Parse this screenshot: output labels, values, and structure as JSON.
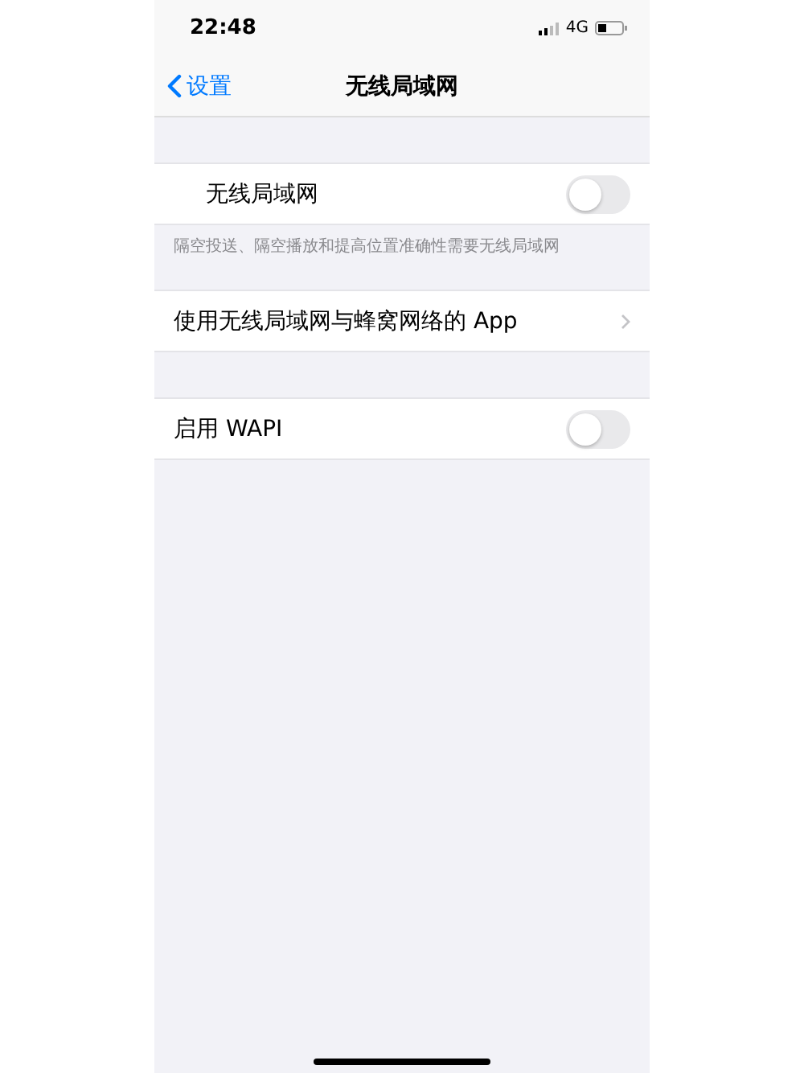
{
  "status_bar": {
    "time": "22:48",
    "network": "4G"
  },
  "nav": {
    "back": "设置",
    "title": "无线局域网"
  },
  "sections": [
    {
      "rows": [
        {
          "kind": "toggle",
          "label": "无线局域网",
          "on": false,
          "indented": true
        }
      ],
      "footer": "隔空投送、隔空播放和提高位置准确性需要无线局域网"
    },
    {
      "rows": [
        {
          "kind": "link",
          "label": "使用无线局域网与蜂窝网络的 App",
          "indented": false
        }
      ]
    },
    {
      "rows": [
        {
          "kind": "toggle",
          "label": "启用 WAPI",
          "on": false,
          "indented": false
        }
      ]
    }
  ]
}
